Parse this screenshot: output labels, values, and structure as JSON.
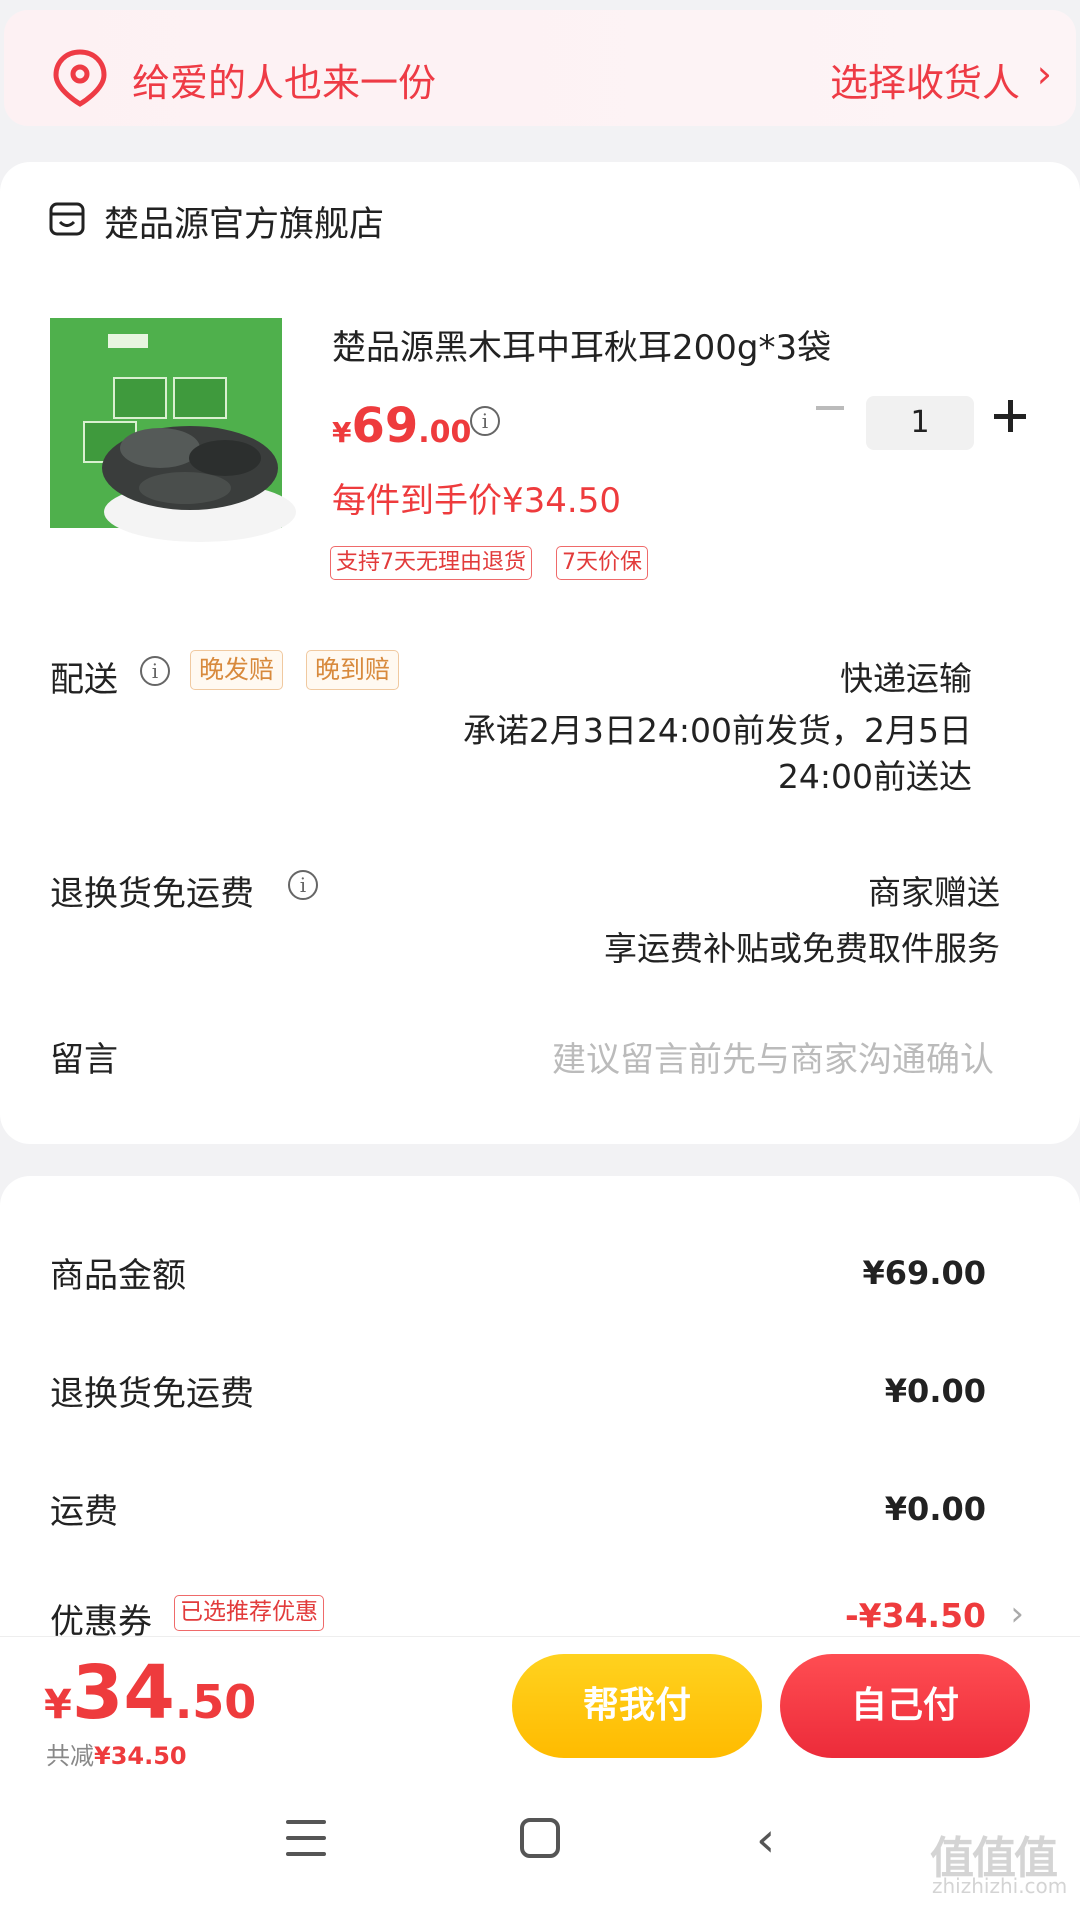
{
  "banner": {
    "text": "给爱的人也来一份",
    "action": "选择收货人",
    "chevron": "›",
    "icon": "location-pin-icon",
    "accent": "#ee3b45"
  },
  "store": {
    "name": "楚品源官方旗舰店",
    "icon": "store-icon"
  },
  "product": {
    "title": "楚品源黑木耳中耳秋耳200g*3袋",
    "price_currency": "¥",
    "price_int": "69",
    "price_dec": ".00",
    "per_item_price": "每件到手价¥34.50",
    "tags": [
      "支持7天无理由退货",
      "7天价保"
    ],
    "quantity": "1",
    "image_icon": "product-image"
  },
  "delivery": {
    "label": "配送",
    "tags": [
      "晚发赔",
      "晚到赔"
    ],
    "method": "快递运输",
    "promise_line1": "承诺2月3日24:00前发货，2月5日",
    "promise_line2": "24:00前送达"
  },
  "return_shipping": {
    "label": "退换货免运费",
    "value": "商家赠送",
    "desc": "享运费补贴或免费取件服务"
  },
  "message": {
    "label": "留言",
    "placeholder": "建议留言前先与商家沟通确认"
  },
  "summary": {
    "goods_label": "商品金额",
    "goods_value": "¥69.00",
    "return_label": "退换货免运费",
    "return_value": "¥0.00",
    "shipping_label": "运费",
    "shipping_value": "¥0.00",
    "coupon_label": "优惠券",
    "coupon_tag": "已选推荐优惠",
    "coupon_value": "-¥34.50",
    "coupon_chevron": "›"
  },
  "footer": {
    "total_currency": "¥",
    "total_int": "34",
    "total_dec": ".50",
    "saved_label": "共减",
    "saved_value": "¥34.50",
    "help_pay": "帮我付",
    "self_pay": "自己付"
  },
  "system_nav": {
    "back": "‹",
    "watermark": "值值值",
    "watermark_sub": "zhizhizhi.com"
  }
}
